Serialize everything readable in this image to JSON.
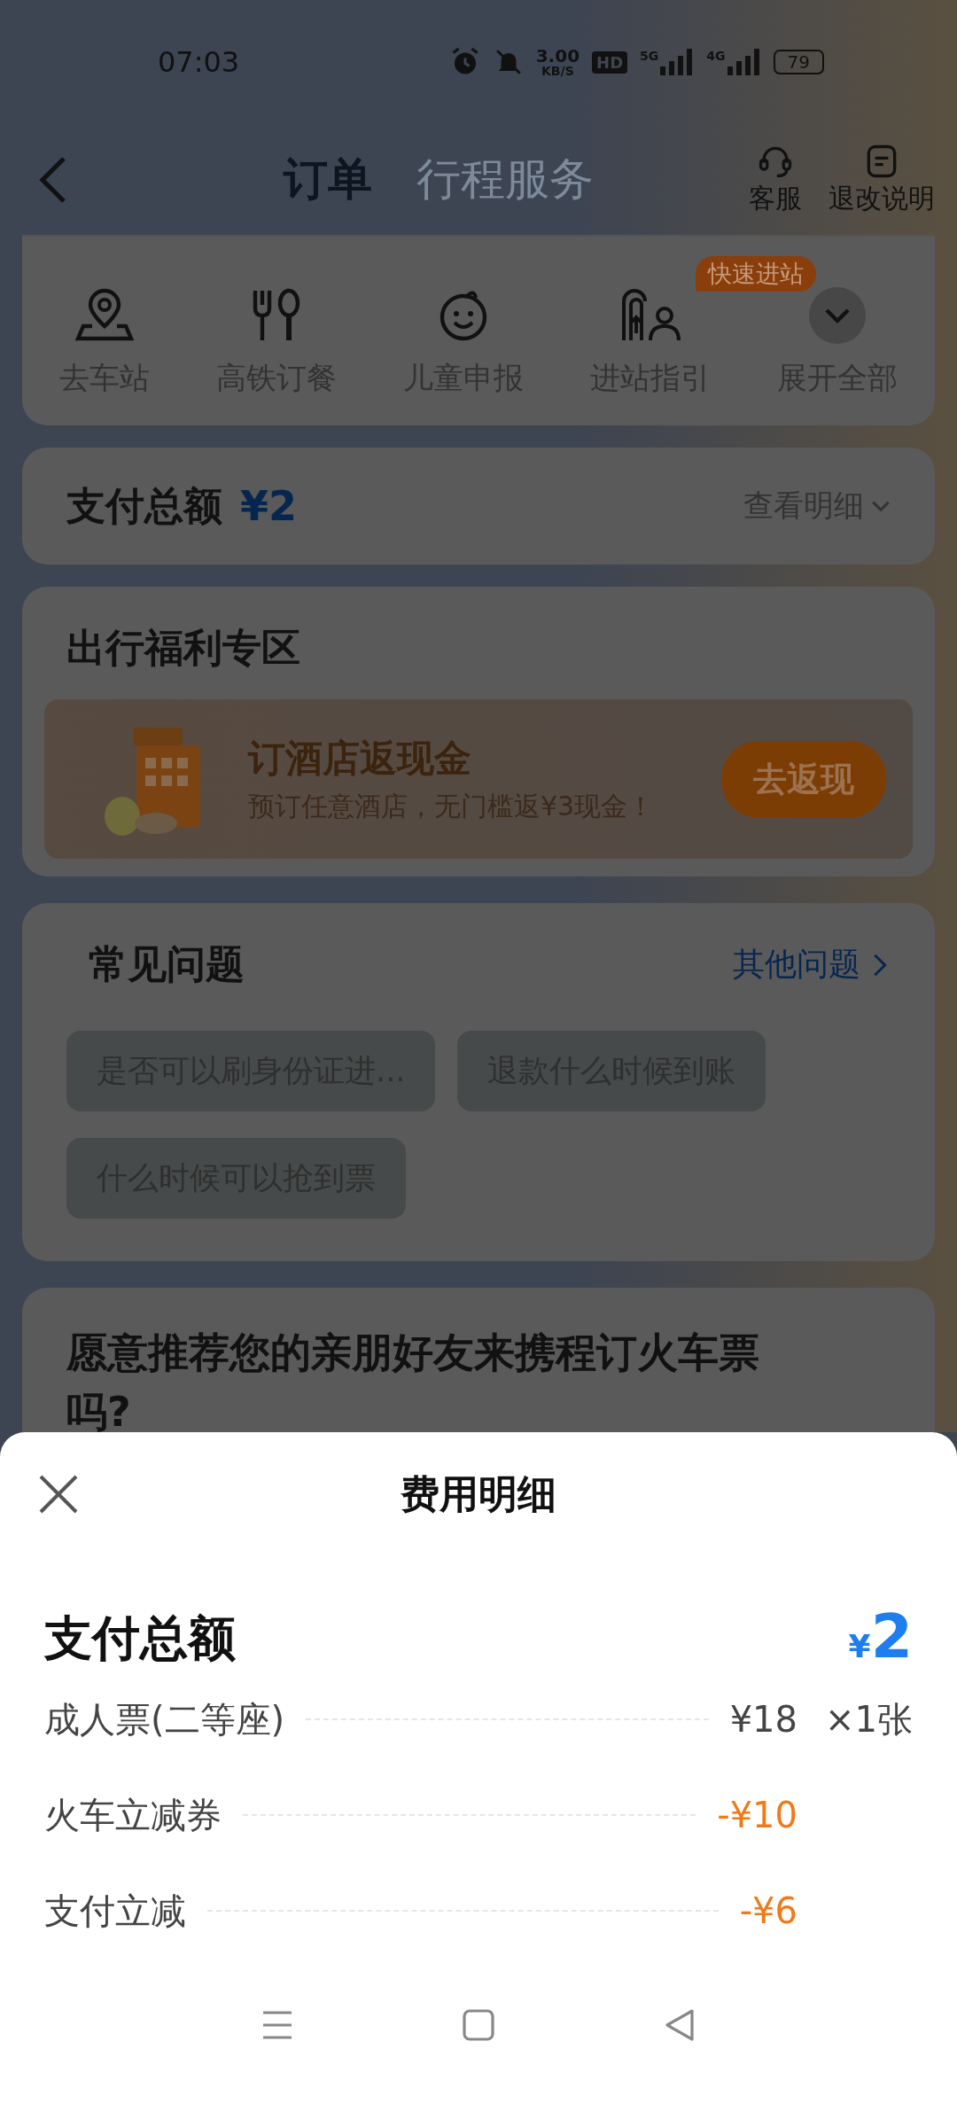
{
  "status_bar": {
    "time": "07:03",
    "net_speed": "3.00",
    "net_unit": "KB/S",
    "hd_badge": "HD",
    "signal_1": "5G",
    "signal_2": "4G",
    "battery": "79"
  },
  "header": {
    "tabs": [
      {
        "label": "订单",
        "selected": true
      },
      {
        "label": "行程服务",
        "selected": false
      }
    ],
    "actions": [
      {
        "kind": "support",
        "label": "客服"
      },
      {
        "kind": "notes",
        "label": "退改说明"
      }
    ]
  },
  "services": [
    {
      "kind": "pin",
      "label": "去车站"
    },
    {
      "kind": "meal",
      "label": "高铁订餐"
    },
    {
      "kind": "child",
      "label": "儿童申报"
    },
    {
      "kind": "guide",
      "label": "进站指引",
      "badge": "快速进站"
    },
    {
      "kind": "expand",
      "label": "展开全部"
    }
  ],
  "payment": {
    "label": "支付总额",
    "amount": "¥2",
    "link": "查看明细"
  },
  "benefits": {
    "title": "出行福利专区",
    "promo": {
      "title": "订酒店返现金",
      "subtitle": "预订任意酒店，无门槛返¥3现金！",
      "button": "去返现"
    }
  },
  "faq": {
    "title": "常见问题",
    "more": "其他问题",
    "questions": [
      "是否可以刷身份证进...",
      "退款什么时候到账",
      "什么时候可以抢到票"
    ]
  },
  "survey": {
    "title": "愿意推荐您的亲朋好友来携程订火车票吗?"
  },
  "sheet": {
    "title": "费用明细",
    "total_label": "支付总额",
    "total_currency": "¥",
    "total_amount": "2",
    "rows": [
      {
        "kind": "charge",
        "label": "成人票(二等座)",
        "amount": "¥18",
        "quantity": "×1张"
      },
      {
        "kind": "discount",
        "label": "火车立减券",
        "amount": "-¥10"
      },
      {
        "kind": "discount",
        "label": "支付立减",
        "amount": "-¥6"
      }
    ]
  }
}
